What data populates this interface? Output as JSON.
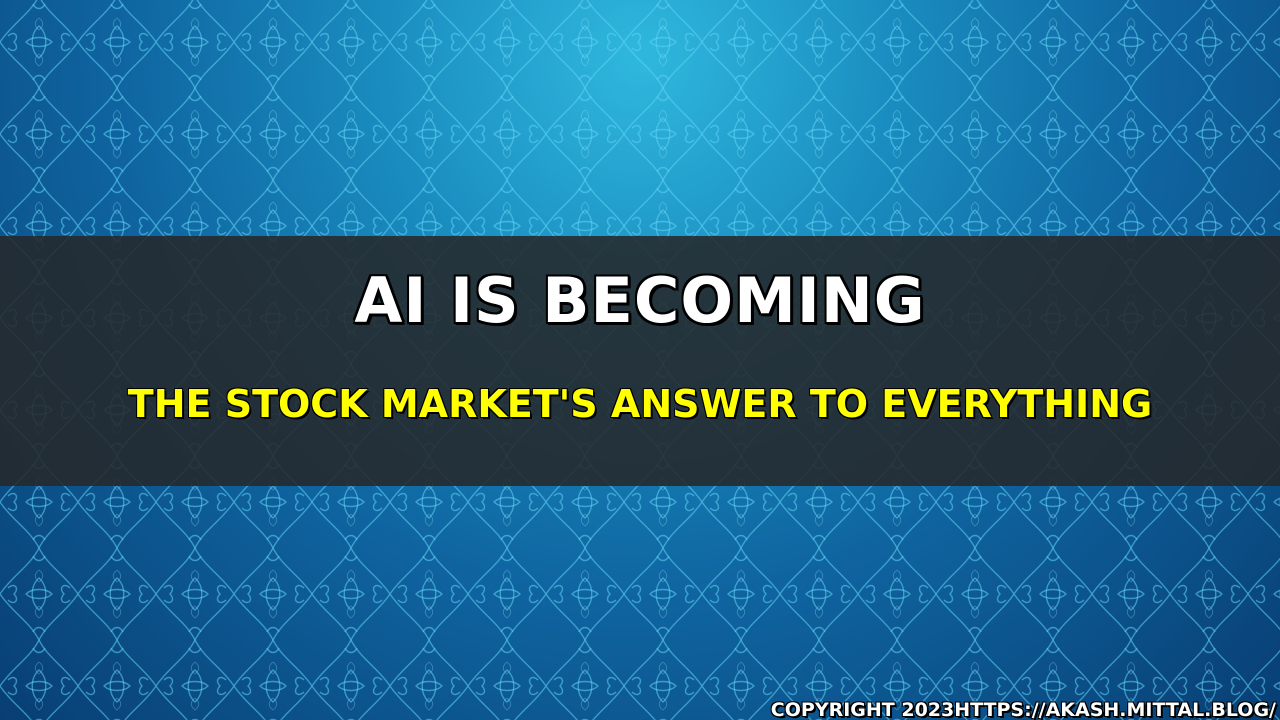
{
  "headline": "AI IS BECOMING",
  "subheadline": "THE STOCK MARKET'S ANSWER TO EVERYTHING",
  "copyright": "COPYRIGHT 2023HTTPS://AKASH.MITTAL.BLOG/",
  "colors": {
    "background_light": "#2fb8de",
    "background_dark": "#083e73",
    "pattern_stroke": "#5fd2f5",
    "banner": "#26282a",
    "headline": "#ffffff",
    "subheadline": "#ffff00"
  }
}
